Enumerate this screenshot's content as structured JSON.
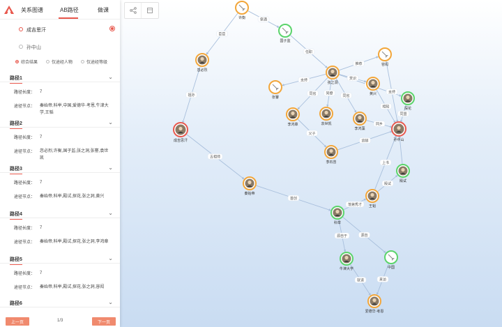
{
  "tabs": [
    {
      "label": "关系图谱"
    },
    {
      "label": "AB路径"
    },
    {
      "label": "做课"
    }
  ],
  "endpoints": {
    "from": "成吉思汗",
    "to": "孙中山"
  },
  "filters": [
    {
      "label": "综合结果"
    },
    {
      "label": "仅途经人物"
    },
    {
      "label": "仅途经等级"
    }
  ],
  "paths": [
    {
      "title": "路径1",
      "length_key": "路径长度：",
      "length_val": "7",
      "nodes_key": "途径节点：",
      "nodes_val": "秦始帝,科举,中国,爱德华·考恩,牛津大学,王韬"
    },
    {
      "title": "路径2",
      "length_key": "路径长度：",
      "length_val": "7",
      "nodes_key": "途径节点：",
      "nodes_val": "忽必烈,许衡,国子监,张之洞,张謇,袁世凯"
    },
    {
      "title": "路径3",
      "length_key": "路径长度：",
      "length_val": "7",
      "nodes_key": "途径节点：",
      "nodes_val": "秦始帝,科举,殿试,探花,张之洞,黄兴"
    },
    {
      "title": "路径4",
      "length_key": "路径长度：",
      "length_val": "7",
      "nodes_key": "途径节点：",
      "nodes_val": "秦始帝,科举,殿试,探花,张之洞,李鸿章"
    },
    {
      "title": "路径5",
      "length_key": "路径长度：",
      "length_val": "7",
      "nodes_key": "途径节点：",
      "nodes_val": "秦始帝,科举,殿试,探花,张之洞,容闳"
    },
    {
      "title": "路径6"
    }
  ],
  "pager": {
    "prev": "上一页",
    "next": "下一页",
    "count": "1/3"
  },
  "colors": {
    "accent": "#e8574c",
    "orange": "#f2a63a",
    "green": "#5bd46b",
    "red": "#e8574c"
  },
  "graph": {
    "nodes": [
      {
        "id": "xuheng",
        "label": "许衡",
        "ring": "orange",
        "icon": "broom-icon"
      },
      {
        "id": "guozijian",
        "label": "国子监",
        "ring": "green",
        "icon": "broom-icon"
      },
      {
        "id": "hubilie",
        "label": "忽必烈",
        "ring": "orange",
        "icon": "portrait-icon"
      },
      {
        "id": "chengjisihan",
        "label": "成吉思汗",
        "ring": "red",
        "icon": "portrait-icon"
      },
      {
        "id": "qinshidi",
        "label": "秦始帝",
        "ring": "orange",
        "icon": "portrait-icon"
      },
      {
        "id": "keju",
        "label": "科举",
        "ring": "green",
        "icon": "portrait-icon"
      },
      {
        "id": "niujin",
        "label": "牛津大学",
        "ring": "green",
        "icon": "portrait-icon"
      },
      {
        "id": "zhongguo",
        "label": "中国",
        "ring": "green",
        "icon": "broom-icon"
      },
      {
        "id": "aidehua",
        "label": "爱德华·考恩",
        "ring": "orange",
        "icon": "portrait-icon"
      },
      {
        "id": "wangtao",
        "label": "王韬",
        "ring": "orange",
        "icon": "portrait-icon"
      },
      {
        "id": "dianshi",
        "label": "殿试",
        "ring": "green",
        "icon": "portrait-icon"
      },
      {
        "id": "sunzhongshan",
        "label": "孙中山",
        "ring": "red",
        "icon": "portrait-icon"
      },
      {
        "id": "tanhua",
        "label": "探花",
        "ring": "green",
        "icon": "portrait-icon"
      },
      {
        "id": "huangxing",
        "label": "黄兴",
        "ring": "orange",
        "icon": "portrait-icon"
      },
      {
        "id": "ronghong",
        "label": "容闳",
        "ring": "orange",
        "icon": "broom-icon"
      },
      {
        "id": "zhangzhidong",
        "label": "张之洞",
        "ring": "orange",
        "icon": "portrait-icon"
      },
      {
        "id": "zhangjian",
        "label": "张謇",
        "ring": "orange",
        "icon": "broom-icon"
      },
      {
        "id": "lihongzhang",
        "label": "李鸿章",
        "ring": "orange",
        "icon": "portrait-icon"
      },
      {
        "id": "yuanshikai",
        "label": "袁世凯",
        "ring": "orange",
        "icon": "portrait-icon"
      },
      {
        "id": "lihongzao",
        "label": "李鸿藻",
        "ring": "orange",
        "icon": "portrait-icon"
      },
      {
        "id": "lishiyu",
        "label": "李石曾",
        "ring": "orange",
        "icon": "portrait-icon"
      }
    ],
    "edges": [
      {
        "from": "xuheng",
        "to": "guozijian",
        "label": "祭酒"
      },
      {
        "from": "xuheng",
        "to": "hubilie",
        "label": "臣臣"
      },
      {
        "from": "hubilie",
        "to": "chengjisihan",
        "label": "祖孙"
      },
      {
        "from": "chengjisihan",
        "to": "qinshidi",
        "label": "五相师"
      },
      {
        "from": "qinshidi",
        "to": "keju",
        "label": "首创"
      },
      {
        "from": "keju",
        "to": "wangtao",
        "label": "落第秀才"
      },
      {
        "from": "keju",
        "to": "zhongguo",
        "label": "源自"
      },
      {
        "from": "keju",
        "to": "niujin",
        "label": "源自于"
      },
      {
        "from": "niujin",
        "to": "aidehua",
        "label": "就读"
      },
      {
        "from": "zhongguo",
        "to": "aidehua",
        "label": "来访"
      },
      {
        "from": "wangtao",
        "to": "dianshi",
        "label": "殿试"
      },
      {
        "from": "wangtao",
        "to": "sunzhongshan",
        "label": "上书"
      },
      {
        "from": "guozijian",
        "to": "zhangzhidong",
        "label": "任职"
      },
      {
        "from": "zhangzhidong",
        "to": "ronghong",
        "label": "推荐"
      },
      {
        "from": "zhangzhidong",
        "to": "huangxing",
        "label": "赏识"
      },
      {
        "from": "zhangzhidong",
        "to": "zhangjian",
        "label": "支持"
      },
      {
        "from": "zhangzhidong",
        "to": "lihongzhang",
        "label": "同省"
      },
      {
        "from": "zhangzhidong",
        "to": "lihongzao",
        "label": "同省"
      },
      {
        "from": "zhangzhidong",
        "to": "yuanshikai",
        "label": "同僚"
      },
      {
        "from": "zhangzhidong",
        "to": "tanhua",
        "label": "探花"
      },
      {
        "from": "lihongzhang",
        "to": "lishiyu",
        "label": "父子"
      },
      {
        "from": "lihongzao",
        "to": "sunzhongshan",
        "label": "同乡"
      },
      {
        "from": "lishiyu",
        "to": "sunzhongshan",
        "label": "追随"
      },
      {
        "from": "huangxing",
        "to": "sunzhongshan",
        "label": "相知"
      },
      {
        "from": "ronghong",
        "to": "sunzhongshan",
        "label": "支持"
      },
      {
        "from": "tanhua",
        "to": "sunzhongshan",
        "label": "同盟"
      },
      {
        "from": "dianshi",
        "to": "sunzhongshan",
        "label": ""
      }
    ]
  }
}
